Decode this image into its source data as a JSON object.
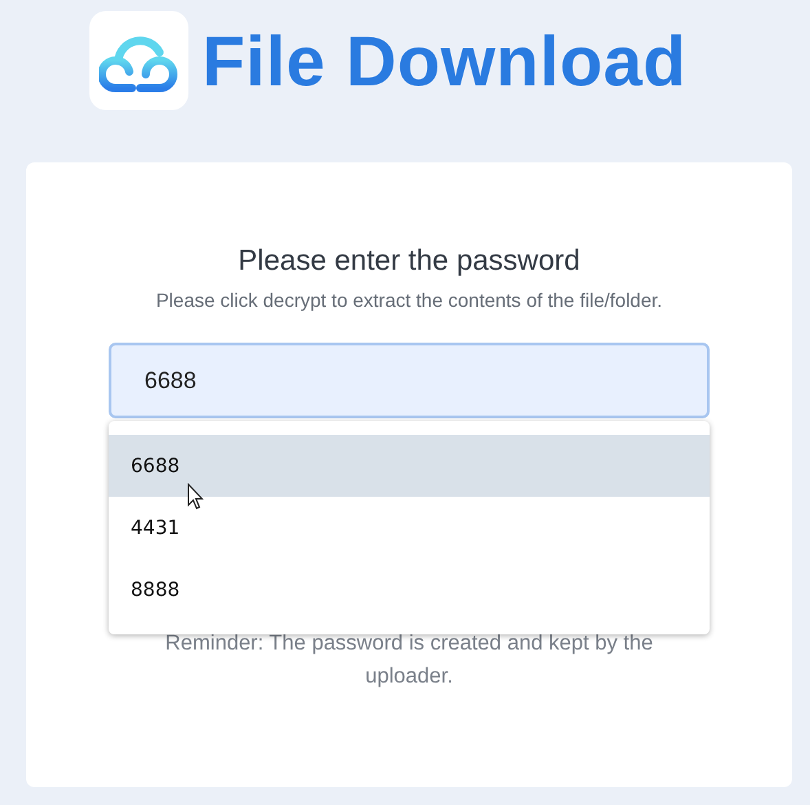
{
  "header": {
    "title": "File Download"
  },
  "card": {
    "heading": "Please enter the password",
    "subtitle": "Please click decrypt to extract the contents of the file/folder.",
    "password_field": {
      "value": "6688"
    },
    "suggestions": [
      {
        "label": "6688",
        "selected": true
      },
      {
        "label": "4431",
        "selected": false
      },
      {
        "label": "8888",
        "selected": false
      }
    ],
    "reminder": "Reminder: The password is created and kept by the uploader."
  }
}
